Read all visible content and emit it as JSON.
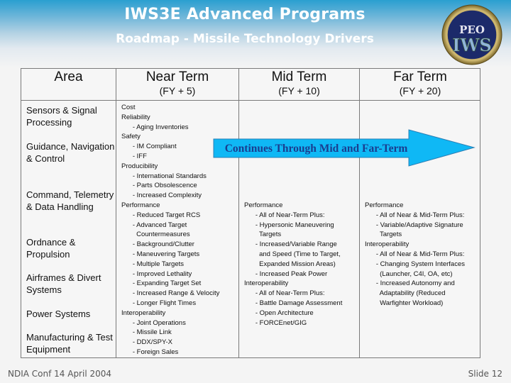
{
  "header": {
    "title": "IWS3E Advanced Programs",
    "subtitle": "Roadmap - Missile Technology Drivers",
    "logo": {
      "icon": "peo-iws-seal-icon",
      "text_top": "PEO",
      "text_bottom": "IWS"
    }
  },
  "table": {
    "columns": [
      {
        "title": "Area",
        "subtitle": ""
      },
      {
        "title": "Near Term",
        "subtitle": "(FY + 5)"
      },
      {
        "title": "Mid Term",
        "subtitle": "(FY + 10)"
      },
      {
        "title": "Far Term",
        "subtitle": "(FY + 20)"
      }
    ],
    "areas": [
      "Sensors & Signal Processing",
      "Guidance, Navigation & Control",
      "Command, Telemetry & Data Handling",
      "Ordnance & Propulsion",
      "Airframes & Divert Systems",
      "Power Systems",
      "Manufacturing & Test Equipment"
    ],
    "near_term": "Cost\nReliability\n      - Aging Inventories\nSafety\n      - IM Compliant\n      - IFF\nProducibility\n      - International Standards\n      - Parts Obsolescence\n      - Increased Complexity\nPerformance\n      - Reduced Target RCS\n      - Advanced Target\n        Countermeasures\n      - Background/Clutter\n      - Maneuvering Targets\n      - Multiple Targets\n      - Improved Lethality\n      - Expanding Target Set\n      - Increased Range & Velocity\n      - Longer Flight Times\nInteroperability\n      - Joint Operations\n      - Missile Link\n      - DDX/SPY-X\n      - Foreign Sales",
    "mid_term": "Performance\n      - All of Near-Term Plus:\n      - Hypersonic Maneuvering\n        Targets\n      - Increased/Variable Range\n        and Speed (Time to Target,\n        Expanded Mission Areas)\n      - Increased Peak Power\nInteroperability\n      - All of Near-Term Plus:\n      - Battle Damage Assessment\n      - Open Architecture\n      - FORCEnet/GIG",
    "far_term": "Performance\n      - All of Near & Mid-Term Plus:\n      - Variable/Adaptive Signature\n        Targets\nInteroperability\n      - All of Near & Mid-Term Plus:\n      - Changing System Interfaces\n        (Launcher, C4I, OA, etc)\n      - Increased Autonomy and\n        Adaptability (Reduced\n        Warfighter Workload)"
  },
  "arrow": {
    "label": "Continues Through Mid and Far-Term",
    "fill_color": "#0fb8f5",
    "text_color": "#1a3d8f",
    "icon": "right-arrow-icon"
  },
  "footer": {
    "left": "NDIA Conf 14 April 2004",
    "right": "Slide 12"
  }
}
